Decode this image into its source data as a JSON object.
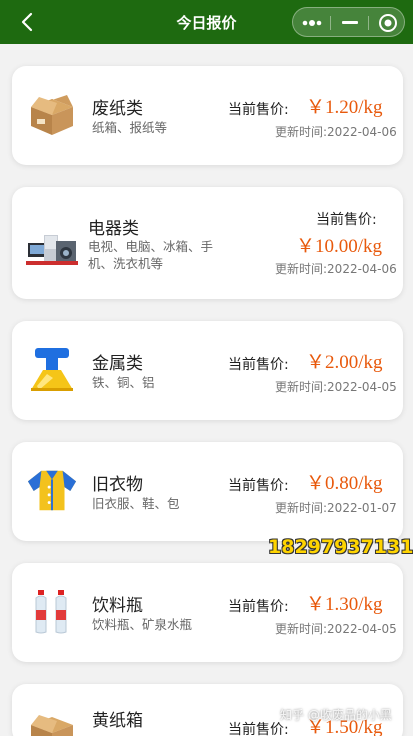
{
  "header": {
    "title": "今日报价"
  },
  "price_label": "当前售价:",
  "items": [
    {
      "name": "废纸类",
      "desc": "纸箱、报纸等",
      "price": "￥1.20/kg",
      "updated": "更新时间:2022-04-06",
      "icon": "cardboard-box-icon"
    },
    {
      "name": "电器类",
      "desc": "电视、电脑、冰箱、手机、洗衣机等",
      "price": "￥10.00/kg",
      "updated": "更新时间:2022-04-06",
      "icon": "appliances-icon"
    },
    {
      "name": "金属类",
      "desc": "铁、铜、铝",
      "price": "￥2.00/kg",
      "updated": "更新时间:2022-04-05",
      "icon": "metal-icon"
    },
    {
      "name": "旧衣物",
      "desc": "旧衣服、鞋、包",
      "price": "￥0.80/kg",
      "updated": "更新时间:2022-01-07",
      "icon": "shirt-icon"
    },
    {
      "name": "饮料瓶",
      "desc": "饮料瓶、矿泉水瓶",
      "price": "￥1.30/kg",
      "updated": "更新时间:2022-04-05",
      "icon": "bottles-icon"
    },
    {
      "name": "黄纸箱",
      "desc": "",
      "price": "￥1.50/kg",
      "updated": "",
      "icon": "cardboard-box-icon"
    }
  ],
  "watermarks": {
    "phone": "18297937131",
    "zhihu": "知乎 @收废品的小黑"
  }
}
